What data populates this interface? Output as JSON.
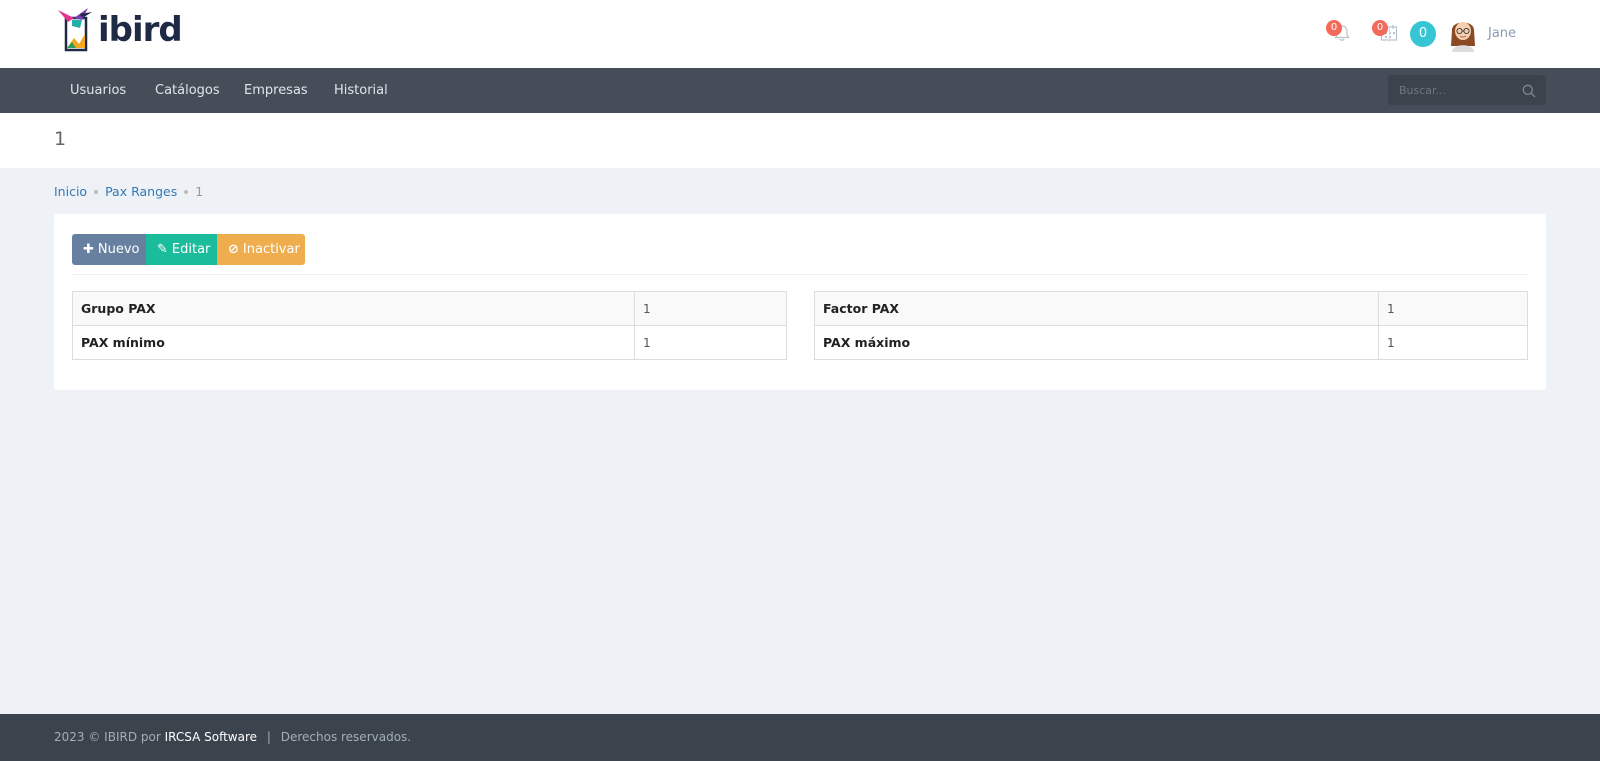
{
  "header": {
    "logo_text": "ibird",
    "notifications_count": "0",
    "calendar_count": "0",
    "inbox_count": "0",
    "user_name": "Jane",
    "colors": {
      "badge": "#f36a5a",
      "inbox_badge": "#36c6d3"
    }
  },
  "nav": {
    "items": [
      {
        "label": "Usuarios"
      },
      {
        "label": "Catálogos"
      },
      {
        "label": "Empresas"
      },
      {
        "label": "Historial"
      }
    ],
    "search_placeholder": "Buscar..."
  },
  "page": {
    "title": "1",
    "breadcrumb": [
      {
        "label": "Inicio"
      },
      {
        "label": "Pax Ranges"
      },
      {
        "label": "1"
      }
    ]
  },
  "actions": {
    "new_label": "Nuevo",
    "edit_label": "Editar",
    "inactivate_label": "Inactivar",
    "colors": {
      "new": "#67809f",
      "edit": "#1bbc9b",
      "inactivate": "#f0ad4e"
    }
  },
  "details": {
    "left": [
      {
        "label": "Grupo PAX",
        "value": "1"
      },
      {
        "label": "PAX mínimo",
        "value": "1"
      }
    ],
    "right": [
      {
        "label": "Factor PAX",
        "value": "1"
      },
      {
        "label": "PAX máximo",
        "value": "1"
      }
    ]
  },
  "footer": {
    "prefix": "2023 © IBIRD por",
    "company": "IRCSA Software",
    "separator": "|",
    "rights": "Derechos reservados."
  }
}
